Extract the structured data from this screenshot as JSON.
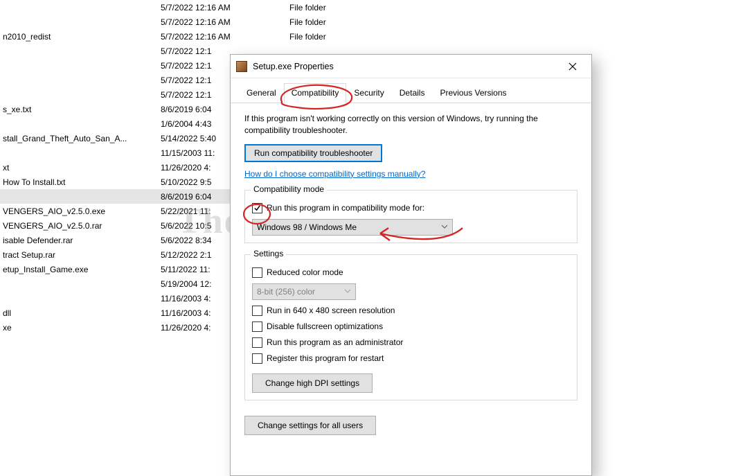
{
  "file_rows": [
    {
      "name": "",
      "date": "5/7/2022 12:16 AM",
      "type": "File folder"
    },
    {
      "name": "",
      "date": "5/7/2022 12:16 AM",
      "type": "File folder"
    },
    {
      "name": "n2010_redist",
      "date": "5/7/2022 12:16 AM",
      "type": "File folder"
    },
    {
      "name": "",
      "date": "5/7/2022 12:1",
      "type": ""
    },
    {
      "name": "",
      "date": "5/7/2022 12:1",
      "type": ""
    },
    {
      "name": "",
      "date": "5/7/2022 12:1",
      "type": ""
    },
    {
      "name": "",
      "date": "5/7/2022 12:1",
      "type": ""
    },
    {
      "name": "s_xe.txt",
      "date": "8/6/2019 6:04",
      "type": ""
    },
    {
      "name": "",
      "date": "1/6/2004 4:43",
      "type": ""
    },
    {
      "name": "stall_Grand_Theft_Auto_San_A...",
      "date": "5/14/2022 5:40",
      "type": ""
    },
    {
      "name": "",
      "date": "11/15/2003 11:",
      "type": ""
    },
    {
      "name": "xt",
      "date": "11/26/2020 4:",
      "type": ""
    },
    {
      "name": " How To Install.txt",
      "date": "5/10/2022 9:5",
      "type": ""
    },
    {
      "name": "",
      "date": "8/6/2019 6:04",
      "type": "",
      "selected": true
    },
    {
      "name": "VENGERS_AIO_v2.5.0.exe",
      "date": "5/22/2021 11:",
      "type": ""
    },
    {
      "name": "VENGERS_AIO_v2.5.0.rar",
      "date": "5/6/2022 10:5",
      "type": ""
    },
    {
      "name": "isable Defender.rar",
      "date": "5/6/2022 8:34",
      "type": ""
    },
    {
      "name": "tract Setup.rar",
      "date": "5/12/2022 2:1",
      "type": ""
    },
    {
      "name": "etup_Install_Game.exe",
      "date": "5/11/2022 11:",
      "type": ""
    },
    {
      "name": "",
      "date": "5/19/2004 12:",
      "type": ""
    },
    {
      "name": "",
      "date": "11/16/2003 4:",
      "type": ""
    },
    {
      "name": "dll",
      "date": "11/16/2003 4:",
      "type": ""
    },
    {
      "name": "xe",
      "date": "11/26/2020 4:",
      "type": ""
    }
  ],
  "watermark_text": "ThongWP.Com",
  "dialog": {
    "title": "Setup.exe Properties",
    "tabs": [
      "General",
      "Compatibility",
      "Security",
      "Details",
      "Previous Versions"
    ],
    "active_tab": "Compatibility",
    "info": "If this program isn't working correctly on this version of Windows, try running the compatibility troubleshooter.",
    "troubleshoot_label": "Run compatibility troubleshooter",
    "manual_link": "How do I choose compatibility settings manually?",
    "compat_group_caption": "Compatibility mode",
    "compat_checkbox_label": "Run this program in compatibility mode for:",
    "compat_checkbox_checked": true,
    "compat_select_value": "Windows 98 / Windows Me",
    "settings_group_caption": "Settings",
    "reduced_color_label": "Reduced color mode",
    "reduced_color_value": "8-bit (256) color",
    "run640_label": "Run in 640 x 480 screen resolution",
    "disable_fullscreen_label": "Disable fullscreen optimizations",
    "run_admin_label": "Run this program as an administrator",
    "register_restart_label": "Register this program for restart",
    "high_dpi_label": "Change high DPI settings",
    "change_all_users_label": "Change settings for all users"
  }
}
